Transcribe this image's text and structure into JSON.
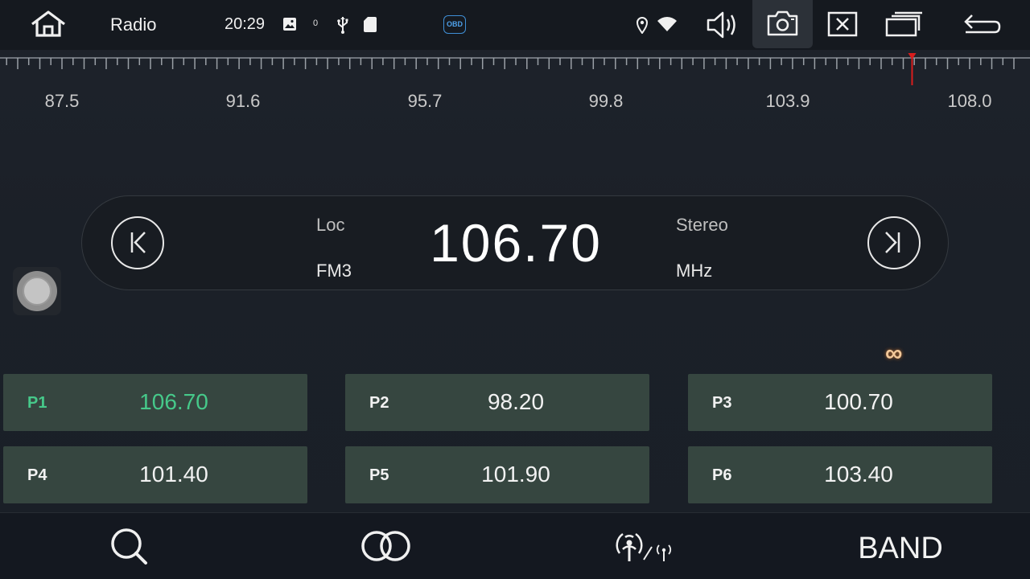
{
  "status_bar": {
    "title": "Radio",
    "time": "20:29",
    "notification_count": "0",
    "obd_label": "OBD",
    "icons": [
      "home-icon",
      "image-icon",
      "usb-icon",
      "sd-card-icon",
      "obd-icon",
      "location-icon",
      "wifi-icon",
      "volume-icon",
      "screenshot-icon",
      "close-icon",
      "multiwindow-icon",
      "back-icon"
    ]
  },
  "scale": {
    "labels": [
      "87.5",
      "91.6",
      "95.7",
      "99.8",
      "103.9",
      "108.0"
    ],
    "min": 87.5,
    "max": 108.0,
    "current": 106.7,
    "marker_color": "#d91d1d"
  },
  "tuner": {
    "loc": "Loc",
    "band": "FM3",
    "frequency": "106.70",
    "stereo": "Stereo",
    "unit": "MHz"
  },
  "loop_indicator": "∞",
  "presets": [
    {
      "num": "P1",
      "freq": "106.70",
      "active": true
    },
    {
      "num": "P2",
      "freq": "98.20",
      "active": false
    },
    {
      "num": "P3",
      "freq": "100.70",
      "active": false
    },
    {
      "num": "P4",
      "freq": "101.40",
      "active": false
    },
    {
      "num": "P5",
      "freq": "101.90",
      "active": false
    },
    {
      "num": "P6",
      "freq": "103.40",
      "active": false
    }
  ],
  "bottom_bar": {
    "band_label": "BAND",
    "icons": [
      "search-icon",
      "stereo-mode-icon",
      "local-distance-icon"
    ]
  },
  "colors": {
    "accent_active": "#46c98a",
    "preset_bg": "#364640",
    "obd": "#3f8fd6"
  }
}
